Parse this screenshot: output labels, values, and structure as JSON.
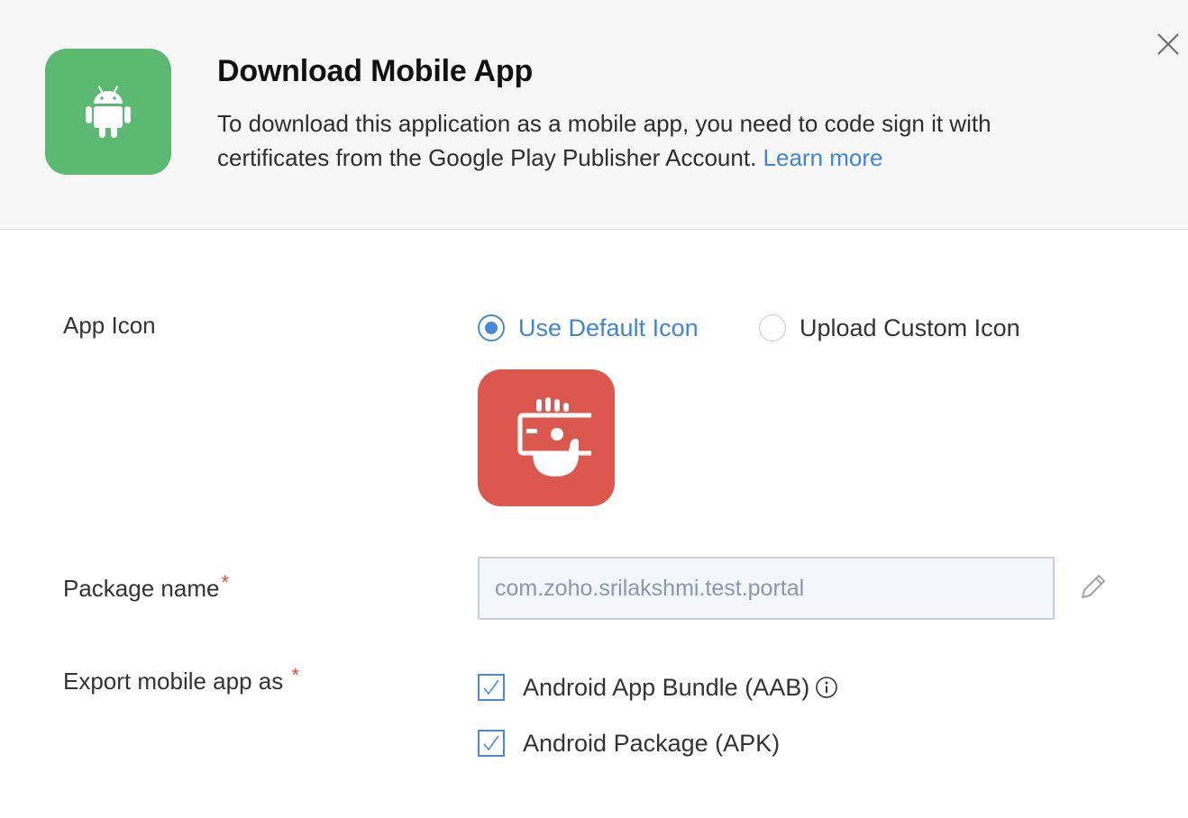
{
  "header": {
    "title": "Download Mobile App",
    "description": "To download this application as a mobile app, you need to code sign it with certificates from the Google Play Publisher Account.",
    "learn_more": "Learn more",
    "badge_color": "#5cb972",
    "badge_icon": "android-icon",
    "close_icon": "close-icon"
  },
  "app_icon": {
    "label": "App Icon",
    "options": [
      {
        "label": "Use Default Icon",
        "selected": true
      },
      {
        "label": "Upload Custom Icon",
        "selected": false
      }
    ],
    "default_icon_color": "#dc574e",
    "default_icon": "hand-holding-card-icon"
  },
  "package": {
    "label": "Package name",
    "required_mark": "*",
    "value": "com.zoho.srilakshmi.test.portal",
    "edit_icon": "pencil-icon"
  },
  "export": {
    "label": "Export mobile app as",
    "required_mark": "*",
    "options": [
      {
        "label": "Android App Bundle (AAB)",
        "checked": true,
        "info_icon": "info-icon"
      },
      {
        "label": "Android Package (APK)",
        "checked": true
      }
    ]
  },
  "colors": {
    "accent": "#3f86cf",
    "required": "#e0483e"
  }
}
